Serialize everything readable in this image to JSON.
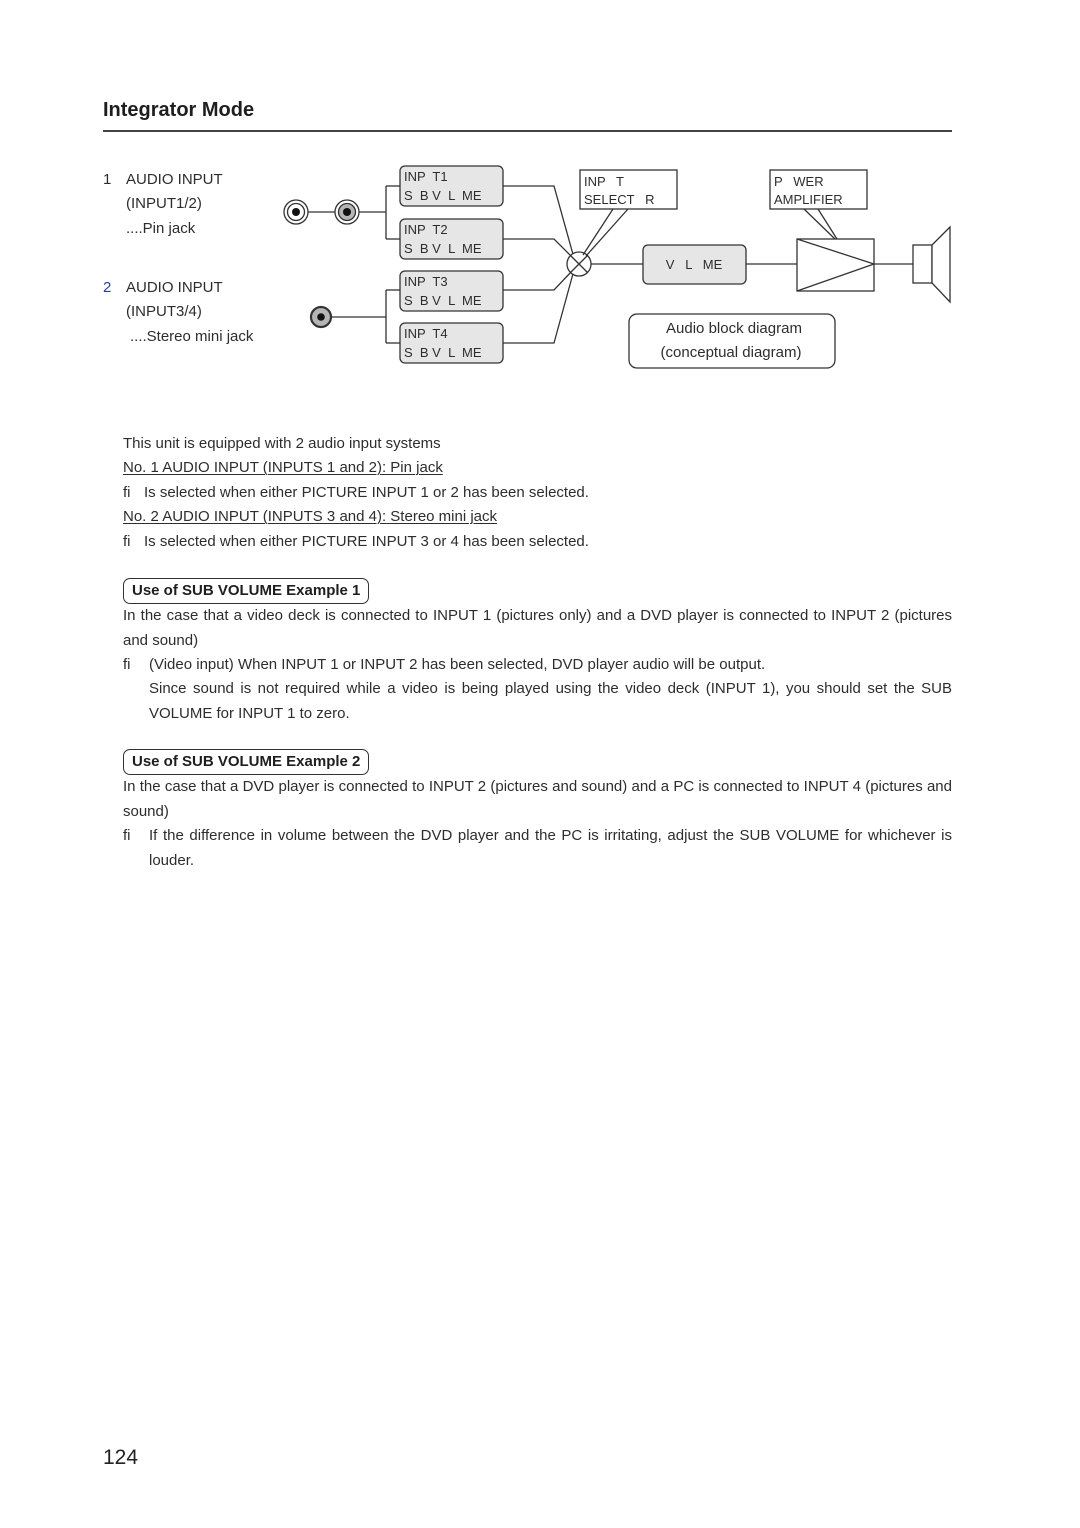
{
  "page": {
    "title": "Integrator Mode",
    "page_number": "124"
  },
  "inputs_legend": [
    {
      "number": "1",
      "line1": "AUDIO INPUT",
      "line2": "(INPUT1/2)",
      "line3": "....Pin jack"
    },
    {
      "number": "2",
      "line1": "AUDIO INPUT",
      "line2": "(INPUT3/4)",
      "line3": "....Stereo mini jack"
    }
  ],
  "diagram": {
    "sub_volume_boxes": [
      {
        "line1": "INP  T1",
        "line2": "S  B V  L  ME"
      },
      {
        "line1": "INP  T2",
        "line2": "S  B V  L  ME"
      },
      {
        "line1": "INP  T3",
        "line2": "S  B V  L  ME"
      },
      {
        "line1": "INP  T4",
        "line2": "S  B V  L  ME"
      }
    ],
    "input_selector": {
      "line1": "INP   T",
      "line2": "SELECT   R"
    },
    "volume": "V   L   ME",
    "power_amplifier": {
      "line1": "P   WER",
      "line2": "AMPLIFIER"
    },
    "caption": {
      "line1": "Audio block diagram",
      "line2": "(conceptual diagram)"
    },
    "colors": {
      "box_fill": "#e6e6e6",
      "stroke": "#333333"
    }
  },
  "intro": {
    "line": "This unit is equipped with 2 audio input systems",
    "items": [
      {
        "heading": "No. 1 AUDIO INPUT (INPUTS 1 and 2): Pin jack",
        "bullet": "fi",
        "text": "Is selected when either PICTURE INPUT 1 or 2 has been selected."
      },
      {
        "heading": "No. 2 AUDIO INPUT (INPUTS 3 and 4): Stereo mini jack",
        "bullet": "fi",
        "text": "Is selected when either PICTURE INPUT 3 or 4 has been selected."
      }
    ]
  },
  "examples": [
    {
      "heading": "Use of SUB VOLUME  Example 1",
      "body": "In the case that a video deck is connected to INPUT 1 (pictures only) and a DVD player is connected to INPUT 2 (pictures and sound)",
      "bullet": "fi",
      "bullet_text": "(Video input) When INPUT 1 or INPUT 2 has been selected, DVD player audio will be output.",
      "bullet_text2": "Since sound is not required while a video is being played using the video deck (INPUT 1), you should set the SUB VOLUME for INPUT 1 to zero."
    },
    {
      "heading": "Use of SUB VOLUME  Example 2",
      "body": "In the case that a DVD player is connected to INPUT 2 (pictures and sound) and a PC is connected to INPUT 4 (pictures and sound)",
      "bullet": "fi",
      "bullet_text": "If the difference in volume between the DVD player and the PC is irritating, adjust the SUB VOLUME for whichever is louder."
    }
  ]
}
